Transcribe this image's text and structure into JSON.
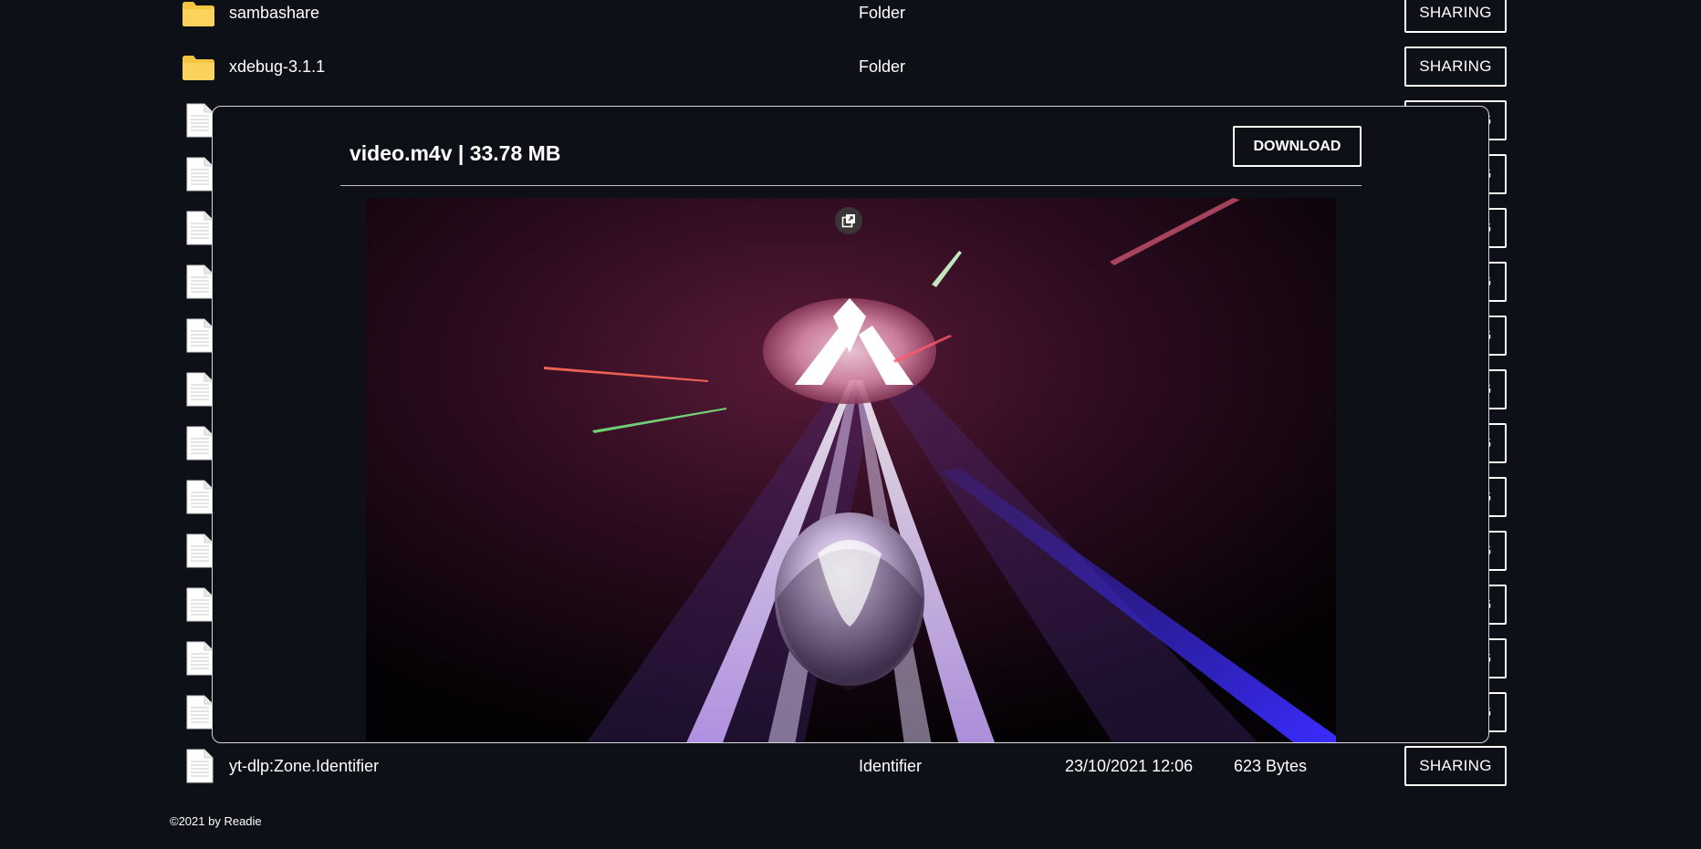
{
  "files": [
    {
      "name": "sambashare",
      "type": "Folder",
      "date": "",
      "size": "",
      "kind": "folder",
      "share_label": "SHARING"
    },
    {
      "name": "xdebug-3.1.1",
      "type": "Folder",
      "date": "",
      "size": "",
      "kind": "folder",
      "share_label": "SHARING"
    },
    {
      "name": "",
      "type": "",
      "date": "",
      "size": "",
      "kind": "file",
      "share_label": "SHARING"
    },
    {
      "name": "",
      "type": "",
      "date": "",
      "size": "",
      "kind": "file",
      "share_label": "SHARING"
    },
    {
      "name": "",
      "type": "",
      "date": "",
      "size": "",
      "kind": "file",
      "share_label": "SHARING"
    },
    {
      "name": "",
      "type": "",
      "date": "",
      "size": "",
      "kind": "file",
      "share_label": "SHARING"
    },
    {
      "name": "",
      "type": "",
      "date": "",
      "size": "",
      "kind": "file",
      "share_label": "SHARING"
    },
    {
      "name": "",
      "type": "",
      "date": "",
      "size": "",
      "kind": "file",
      "share_label": "SHARING"
    },
    {
      "name": "",
      "type": "",
      "date": "",
      "size": "",
      "kind": "file",
      "share_label": "SHARING"
    },
    {
      "name": "",
      "type": "",
      "date": "",
      "size": "",
      "kind": "file",
      "share_label": "SHARING"
    },
    {
      "name": "",
      "type": "",
      "date": "",
      "size": "",
      "kind": "file",
      "share_label": "SHARING"
    },
    {
      "name": "",
      "type": "",
      "date": "",
      "size": "",
      "kind": "file",
      "share_label": "SHARING"
    },
    {
      "name": "",
      "type": "",
      "date": "",
      "size": "",
      "kind": "file",
      "share_label": "SHARING"
    },
    {
      "name": "",
      "type": "",
      "date": "",
      "size": "",
      "kind": "file",
      "share_label": "SHARING"
    },
    {
      "name": "yt-dlp:Zone.Identifier",
      "type": "Identifier",
      "date": "23/10/2021 12:06",
      "size": "623 Bytes",
      "kind": "file",
      "share_label": "SHARING"
    }
  ],
  "footer": {
    "text": "©2021 by Readie"
  },
  "modal": {
    "title": "video.m4v | 33.78 MB",
    "download_label": "DOWNLOAD",
    "pip_icon": "picture-in-picture-icon"
  },
  "icons": {
    "folder": "folder-icon",
    "file": "file-icon"
  },
  "colors": {
    "background": "#0d1017",
    "text": "#ffffff",
    "folder": "#f5c542"
  }
}
